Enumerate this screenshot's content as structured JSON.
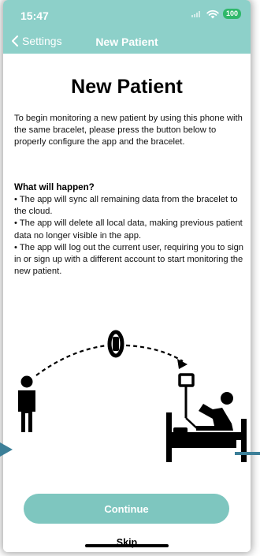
{
  "status": {
    "time": "15:47",
    "battery": "100"
  },
  "nav": {
    "back_label": "Settings",
    "title": "New Patient"
  },
  "page": {
    "title": "New Patient",
    "intro": "To begin monitoring a new patient by using this phone with the same bracelet, please press the button below to properly configure the app and the bracelet.",
    "section_heading": "What will happen?",
    "bullets": [
      "• The app will sync all remaining data from the bracelet to the cloud.",
      "• The app will delete all local data, making previous patient data no longer visible in the app.",
      "• The app will log out the current user, requiring you to sign in or sign up with a different account to start monitoring the new patient."
    ]
  },
  "actions": {
    "continue_label": "Continue",
    "skip_label": "Skip"
  },
  "colors": {
    "accent": "#8dd0c9",
    "button": "#7ec6bf",
    "battery": "#2fb86a",
    "pointer": "#3c7f98"
  },
  "icons": [
    "chevron-left-icon",
    "wifi-icon",
    "signal-icon",
    "person-icon",
    "bracelet-icon",
    "hospital-bed-icon"
  ]
}
